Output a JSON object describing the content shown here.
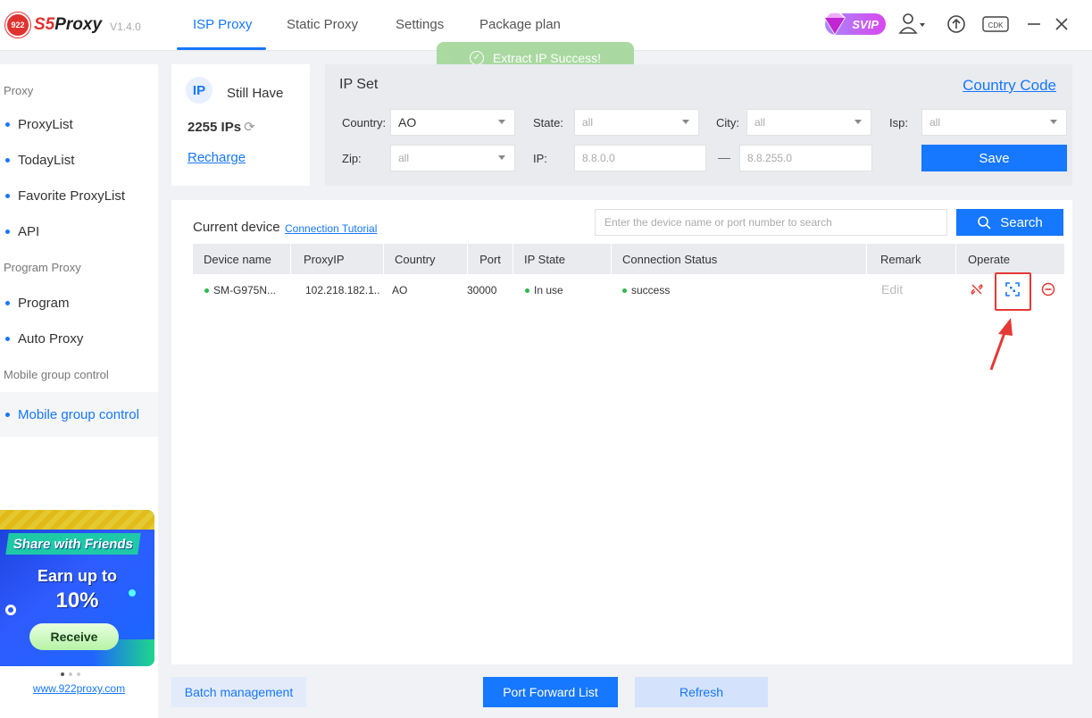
{
  "app": {
    "logo_badge": "922",
    "brand_prefix": "S5",
    "brand_suffix": "Proxy",
    "version": "V1.4.0"
  },
  "nav": {
    "tabs": [
      {
        "label": "ISP Proxy",
        "active": true
      },
      {
        "label": "Static Proxy"
      },
      {
        "label": "Settings"
      },
      {
        "label": "Package plan"
      }
    ]
  },
  "header": {
    "svip_label": "SVIP",
    "cdk_label": "CDK"
  },
  "toast": {
    "message": "Extract IP Success!"
  },
  "sidebar": {
    "groups": [
      {
        "label": "Proxy",
        "items": [
          "ProxyList",
          "TodayList",
          "Favorite ProxyList",
          "API"
        ]
      },
      {
        "label": "Program Proxy",
        "items": [
          "Program",
          "Auto Proxy"
        ]
      },
      {
        "label": "Mobile group control",
        "items": [
          "Mobile group control"
        ]
      }
    ],
    "active_item": "Mobile group control",
    "banner": {
      "title": "Share with Friends",
      "line1": "Earn up to",
      "percent": "10%",
      "button": "Receive"
    },
    "site_link": "www.922proxy.com"
  },
  "ip_card": {
    "icon_text": "IP",
    "still_have": "Still Have",
    "count": "2255 IPs",
    "recharge": "Recharge"
  },
  "ip_set": {
    "title": "IP Set",
    "country_code_link": "Country Code",
    "country_label": "Country:",
    "country_value": "AO",
    "state_label": "State:",
    "state_value": "all",
    "city_label": "City:",
    "city_value": "all",
    "isp_label": "Isp:",
    "isp_value": "all",
    "zip_label": "Zip:",
    "zip_value": "all",
    "ip_label": "IP:",
    "ip_from": "8.8.0.0",
    "ip_dash": "—",
    "ip_to": "8.8.255.0",
    "save": "Save"
  },
  "devices": {
    "title": "Current device",
    "tutorial_link": "Connection Tutorial",
    "search_placeholder": "Enter the device name or port number to search",
    "search_button": "Search",
    "columns": [
      "Device name",
      "ProxyIP",
      "Country",
      "Port",
      "IP State",
      "Connection Status",
      "Remark",
      "Operate"
    ],
    "rows": [
      {
        "device": "SM-G975N...",
        "proxy_ip": "102.218.182.1..",
        "country": "AO",
        "port": "30000",
        "ip_state": "In use",
        "status": "success",
        "remark": "Edit"
      }
    ]
  },
  "footer": {
    "batch": "Batch management",
    "port_forward": "Port Forward List",
    "refresh": "Refresh"
  },
  "colors": {
    "accent": "#1677ff",
    "danger": "#e53935",
    "success": "#2db84d"
  }
}
